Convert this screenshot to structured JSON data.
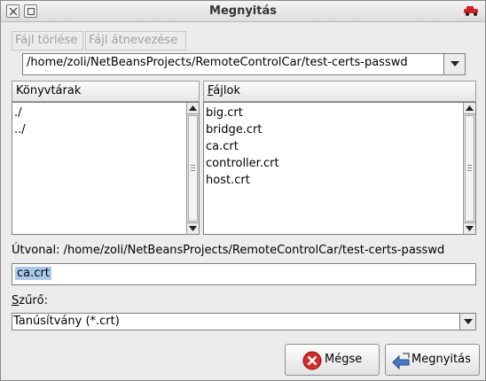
{
  "window": {
    "title": "Megnyitás",
    "close_icon": "close-icon",
    "maximize_icon": "maximize-icon",
    "app_icon": "red-car-icon"
  },
  "toolbar": {
    "delete_file": {
      "pre": "Fá",
      "ul": "j",
      "post": "l törlése"
    },
    "rename_file": {
      "pre": "Fájl átnevezése",
      "ul": "",
      "post": ""
    }
  },
  "path_combo": {
    "value": "/home/zoli/NetBeansProjects/RemoteControlCar/test-certs-passwd"
  },
  "folders": {
    "header": "Könyvtárak",
    "items": [
      "./",
      "../"
    ]
  },
  "files": {
    "header_ul": "F",
    "header_rest": "ájlok",
    "items": [
      "big.crt",
      "bridge.crt",
      "ca.crt",
      "controller.crt",
      "host.crt"
    ]
  },
  "location": {
    "label": "Útvonal: ",
    "value": "/home/zoli/NetBeansProjects/RemoteControlCar/test-certs-passwd"
  },
  "filename": {
    "value": "ca.crt"
  },
  "filter": {
    "label_ul": "S",
    "label_rest": "zűrő:",
    "selected": "Tanúsítvány (*.crt)"
  },
  "buttons": {
    "cancel": "Mégse",
    "open": "Megnyitás"
  },
  "colors": {
    "selection": "#aac8ec",
    "cancel_icon": "#d42b2b",
    "open_icon": "#4a78c8"
  }
}
